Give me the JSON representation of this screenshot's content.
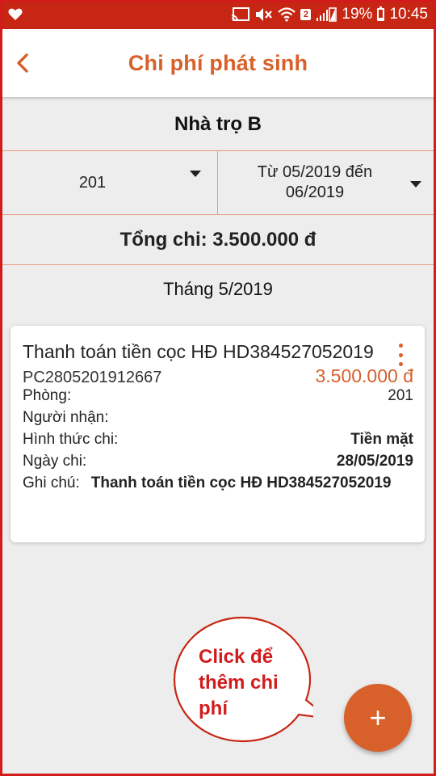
{
  "status_bar": {
    "battery": "19%",
    "time": "10:45",
    "sim_badge": "2",
    "icons": [
      "heart-icon",
      "cast-icon",
      "mute-icon",
      "wifi-icon",
      "signal-icon",
      "battery-icon"
    ]
  },
  "app_bar": {
    "title": "Chi phí phát sinh",
    "back_icon": "chevron-left-icon"
  },
  "header": {
    "house_name": "Nhà trọ B"
  },
  "filters": {
    "room": "201",
    "date_range": "Từ 05/2019 đến 06/2019"
  },
  "summary": {
    "total": "Tổng chi: 3.500.000 đ"
  },
  "month_group": "Tháng 5/2019",
  "expense": {
    "title": "Thanh toán tiền cọc HĐ HD384527052019",
    "code": "PC2805201912667",
    "amount": "3.500.000 đ",
    "room_label": "Phòng:",
    "room_value": "201",
    "receiver_label": "Người nhận:",
    "method_label": "Hình thức chi:",
    "method_value": "Tiền mặt",
    "date_label": "Ngày chi:",
    "date_value": "28/05/2019",
    "note_label": "Ghi chú:",
    "note_value": "Thanh toán tiền cọc HĐ HD384527052019"
  },
  "callout": {
    "text": "Click để thêm chi phí"
  },
  "fab": {
    "label": "+"
  },
  "colors": {
    "status_bar": "#c62613",
    "accent": "#d8602b",
    "frame": "#d21c1c",
    "background": "#ededed"
  }
}
